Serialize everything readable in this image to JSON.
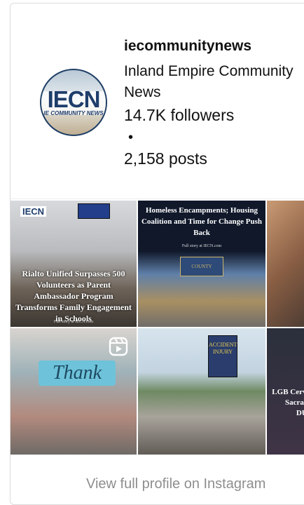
{
  "profile": {
    "username": "iecommunitynews",
    "full_name": "Inland Empire Community News",
    "followers": "14.7K followers",
    "separator": "•",
    "posts": "2,158 posts",
    "avatar_logo": "IECN",
    "avatar_tagline": "IE COMMUNITY NEWS"
  },
  "posts": [
    {
      "header": "IECN",
      "caption": "Rialto Unified Surpasses 500 Volunteers as Parent Ambassador Program Transforms Family Engagement in Schools",
      "footer": "Full story at IECN.com"
    },
    {
      "caption": "Homeless Encampments; Housing Coalition and Time for Change Push Back",
      "footer": "Full story at IECN.com",
      "sign": "COUNTY"
    },
    {},
    {
      "banner": "Thank",
      "icon": "reel-icon"
    },
    {
      "sign": "ACCIDENT INJURY"
    },
    {
      "caption": "LGB Cerva Sacram DUI"
    }
  ],
  "footer_link": "View full profile on Instagram",
  "colors": {
    "brand_navy": "#1e3d6b",
    "muted_text": "#8e8e8e",
    "border": "#dbdbdb"
  }
}
